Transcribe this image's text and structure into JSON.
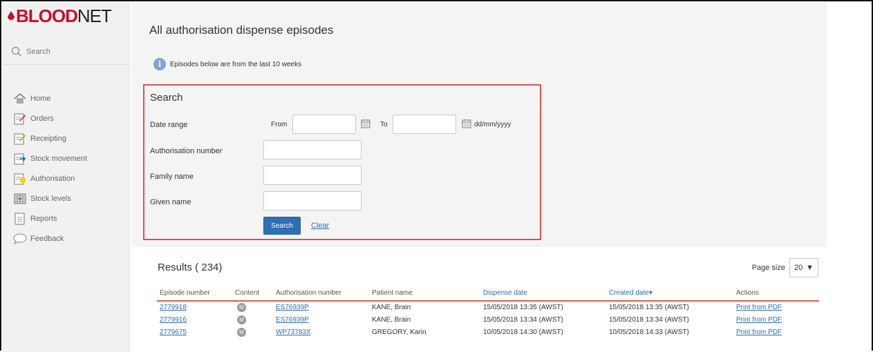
{
  "brand": {
    "blood": "BLOOD",
    "net": "NET",
    "accent": "#c8102e"
  },
  "sidebar": {
    "search_label": "Search",
    "items": [
      {
        "label": "Home",
        "icon": "home-icon"
      },
      {
        "label": "Orders",
        "icon": "orders-icon"
      },
      {
        "label": "Receipting",
        "icon": "receipting-icon"
      },
      {
        "label": "Stock movement",
        "icon": "stock-movement-icon"
      },
      {
        "label": "Authorisation",
        "icon": "authorisation-icon"
      },
      {
        "label": "Stock levels",
        "icon": "stock-levels-icon"
      },
      {
        "label": "Reports",
        "icon": "reports-icon"
      },
      {
        "label": "Feedback",
        "icon": "feedback-icon"
      }
    ]
  },
  "main": {
    "title": "All authorisation dispense episodes",
    "info": "Episodes below are from the last 10 weeks"
  },
  "search_panel": {
    "title": "Search",
    "date_range_label": "Date range",
    "from_label": "From",
    "to_label": "To",
    "date_format": "dd/mm/yyyy",
    "auth_number_label": "Authorisation number",
    "family_name_label": "Family name",
    "given_name_label": "Given name",
    "search_button": "Search",
    "clear_link": "Clear",
    "highlight_color": "#d9534f"
  },
  "results": {
    "title": "Results ( 234)",
    "page_size_label": "Page size",
    "page_size_value": "20",
    "columns": [
      "Episode number",
      "Content",
      "Authorisation number",
      "Patient name",
      "Dispense date",
      "Created date▾",
      "Actions"
    ],
    "rows": [
      {
        "episode": "2779918",
        "content": "M",
        "auth": "ES76939P",
        "patient": "KANE, Brain",
        "dispense": "15/05/2018 13:35 (AWST)",
        "created": "15/05/2018 13:35 (AWST)",
        "action": "Print from PDF"
      },
      {
        "episode": "2779916",
        "content": "M",
        "auth": "ES76939P",
        "patient": "KANE, Brain",
        "dispense": "15/05/2018 13:34 (AWST)",
        "created": "15/05/2018 13:34 (AWST)",
        "action": "Print from PDF"
      },
      {
        "episode": "2779675",
        "content": "M",
        "auth": "WP73783X",
        "patient": "GREGORY, Karin",
        "dispense": "10/05/2018 14:30 (AWST)",
        "created": "10/05/2018 14:33 (AWST)",
        "action": "Print from PDF"
      }
    ]
  }
}
